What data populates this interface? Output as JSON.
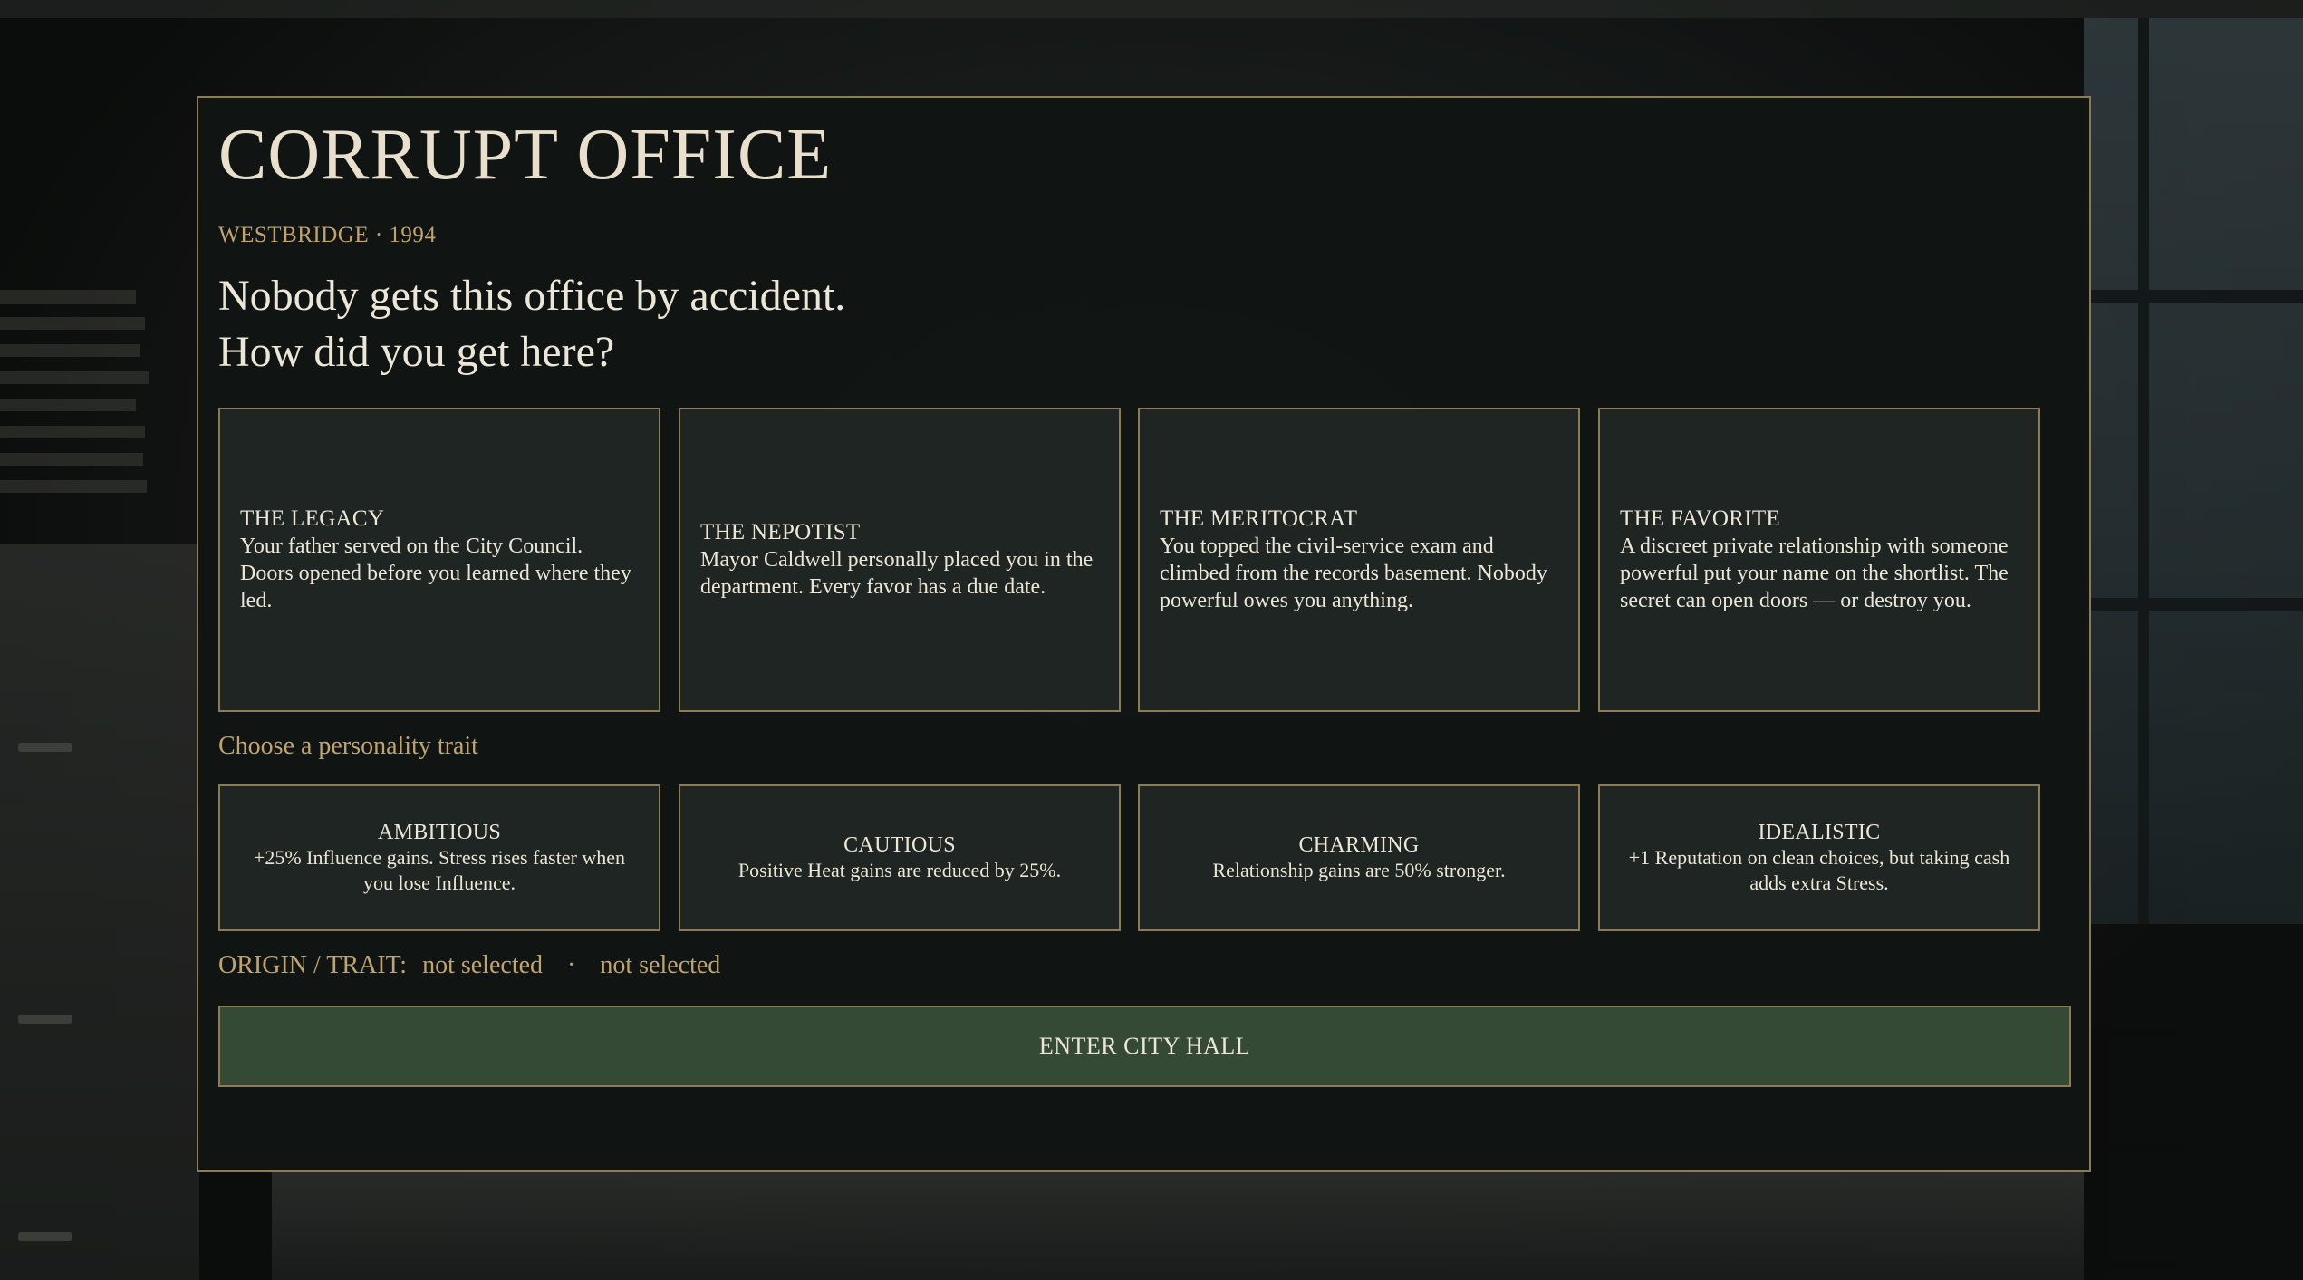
{
  "colors": {
    "accent_gold": "#c2a46a",
    "border_gold": "#8c7b55",
    "panel_bg": "#111514",
    "card_bg": "#1e2523",
    "button_green": "#344a35",
    "text_light": "#ece6d6"
  },
  "header": {
    "title": "CORRUPT OFFICE",
    "subtitle": "WESTBRIDGE · 1994",
    "question_line1": "Nobody gets this office by accident.",
    "question_line2": "How did you get here?"
  },
  "origins": [
    {
      "title": "THE LEGACY",
      "description": "Your father served on the City Council. Doors opened before you learned where they led."
    },
    {
      "title": "THE NEPOTIST",
      "description": "Mayor Caldwell personally placed you in the department. Every favor has a due date."
    },
    {
      "title": "THE MERITOCRAT",
      "description": "You topped the civil-service exam and climbed from the records basement. Nobody powerful owes you anything."
    },
    {
      "title": "THE FAVORITE",
      "description": "A discreet private relationship with someone powerful put your name on the shortlist. The secret can open doors — or destroy you."
    }
  ],
  "traits_label": "Choose a personality trait",
  "traits": [
    {
      "title": "AMBITIOUS",
      "description": "+25% Influence gains. Stress rises faster when you lose Influence."
    },
    {
      "title": "CAUTIOUS",
      "description": "Positive Heat gains are reduced by 25%."
    },
    {
      "title": "CHARMING",
      "description": "Relationship gains are 50% stronger."
    },
    {
      "title": "IDEALISTIC",
      "description": "+1 Reputation on clean choices, but taking cash adds extra Stress."
    }
  ],
  "status": {
    "label": "ORIGIN / TRAIT:",
    "origin_value": "not selected",
    "separator": "·",
    "trait_value": "not selected"
  },
  "enter_button_label": "ENTER CITY HALL"
}
